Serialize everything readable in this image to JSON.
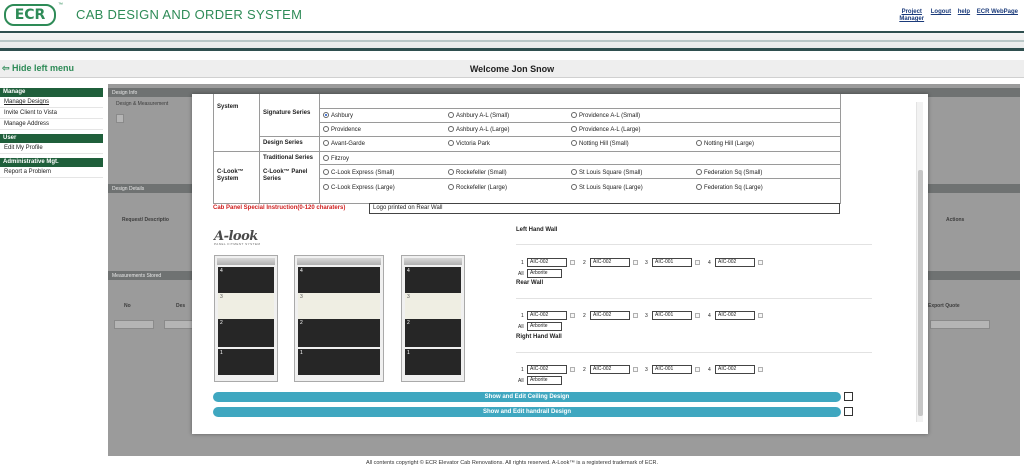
{
  "header": {
    "logo": "ECR",
    "logo_tm": "™",
    "title": "CAB DESIGN AND ORDER SYSTEM",
    "links": {
      "project": "Project",
      "manager": "Manager",
      "logout": "Logout",
      "help": "help",
      "webpage": "ECR WebPage"
    }
  },
  "welcome_bar": {
    "hide_menu": "⇦ Hide left menu",
    "welcome": "Welcome Jon Snow"
  },
  "sidebar": {
    "sections": [
      {
        "title": "Manage",
        "items": [
          "Manage Designs",
          "Invite Client to Vista",
          "Manage Address"
        ]
      },
      {
        "title": "User",
        "items": [
          "Edit My Profile"
        ]
      },
      {
        "title": "Administrative Mgt.",
        "items": [
          "Report a Problem"
        ]
      }
    ]
  },
  "background": {
    "panels": [
      "Design Info",
      "Design Details",
      "Measurements Stored"
    ],
    "labels": [
      "Design & Measurement",
      "Design Details",
      "Request/ Descriptio",
      "Actions",
      "Export Quote",
      "No",
      "Des"
    ]
  },
  "modal": {
    "row_system": "System",
    "signature_series": {
      "label": "Signature Series",
      "options": [
        "Ashbury",
        "Ashbury A-L (Small)",
        "Providence A-L (Small)",
        "Providence",
        "Ashbury A-L (Large)",
        "Providence A-L (Large)"
      ],
      "selected": "Ashbury"
    },
    "design_series": {
      "label": "Design Series",
      "options": [
        "Avant-Garde",
        "Victoria Park",
        "Notting Hill (Small)",
        "Notting Hill (Large)"
      ]
    },
    "traditional_series": {
      "label": "Traditional Series",
      "options": [
        "Fitzroy"
      ]
    },
    "clook_system": "C-Look™ System",
    "clook_panel_series": {
      "label": "C-Look™ Panel Series",
      "options": [
        "C-Look Express (Small)",
        "Rockefeller (Small)",
        "St Louis Square (Small)",
        "Federation Sq (Small)",
        "C-Look Express (Large)",
        "Rockefeller (Large)",
        "St Louis Square (Large)",
        "Federation Sq (Large)"
      ]
    },
    "special_instruction": {
      "label": "Cab Panel Special Instruction(0-120 charaters)",
      "value": "Logo printed on Rear Wall"
    },
    "alook": {
      "word": "A-look",
      "sub": "PANEL FITMENT SYSTEM"
    },
    "walls": [
      {
        "title": "Left Hand Wall",
        "fields": [
          "AIC-002",
          "AIC-002",
          "AIC-001",
          "AIC-002"
        ],
        "all": "Arborite"
      },
      {
        "title": "Rear Wall",
        "fields": [
          "AIC-002",
          "AIC-002",
          "AIC-001",
          "AIC-002"
        ],
        "all": "Arborite"
      },
      {
        "title": "Right Hand Wall",
        "fields": [
          "AIC-002",
          "AIC-002",
          "AIC-001",
          "AIC-002"
        ],
        "all": "Arborite"
      }
    ],
    "field_numbers": [
      "1",
      "2",
      "3",
      "4"
    ],
    "all_label": "All",
    "buttons": {
      "ceiling": "Show and Edit Ceiling Design",
      "handrail": "Show and Edit handrail Design"
    }
  },
  "footer": "All contents copyright © ECR Elevator Cab Renovations. All rights reserved. A-Look™ is a registered trademark of ECR."
}
